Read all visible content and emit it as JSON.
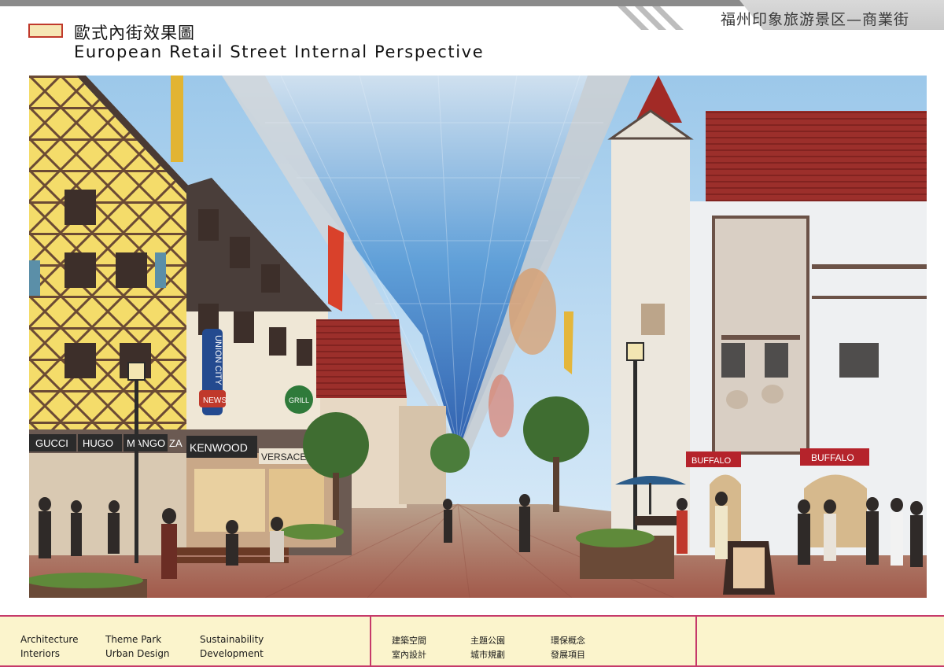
{
  "header": {
    "project_title": "福州印象旅游景区—商業街",
    "title_cn": "歐式內街效果圖",
    "title_en": "European Retail Street Internal Perspective"
  },
  "rendering": {
    "signs": {
      "gucci": "GUCCI",
      "hugo": "HUGO",
      "mango": "MANGO",
      "za": "ZA",
      "kenwood": "KENWOOD",
      "versace": "VERSACE",
      "union_city": "UNION CITY",
      "news": "NEWS",
      "grill": "GRILL",
      "buffalo_1": "BUFFALO",
      "buffalo_2": "BUFFALO"
    }
  },
  "footer": {
    "en": {
      "col1": [
        "Architecture",
        "Interiors"
      ],
      "col2": [
        "Theme Park",
        "Urban Design"
      ],
      "col3": [
        "Sustainability",
        "Development"
      ]
    },
    "cn": {
      "col1": [
        "建築空間",
        "室內設計"
      ],
      "col2": [
        "主題公園",
        "城市規劃"
      ],
      "col3": [
        "環保概念",
        "發展項目"
      ]
    }
  }
}
